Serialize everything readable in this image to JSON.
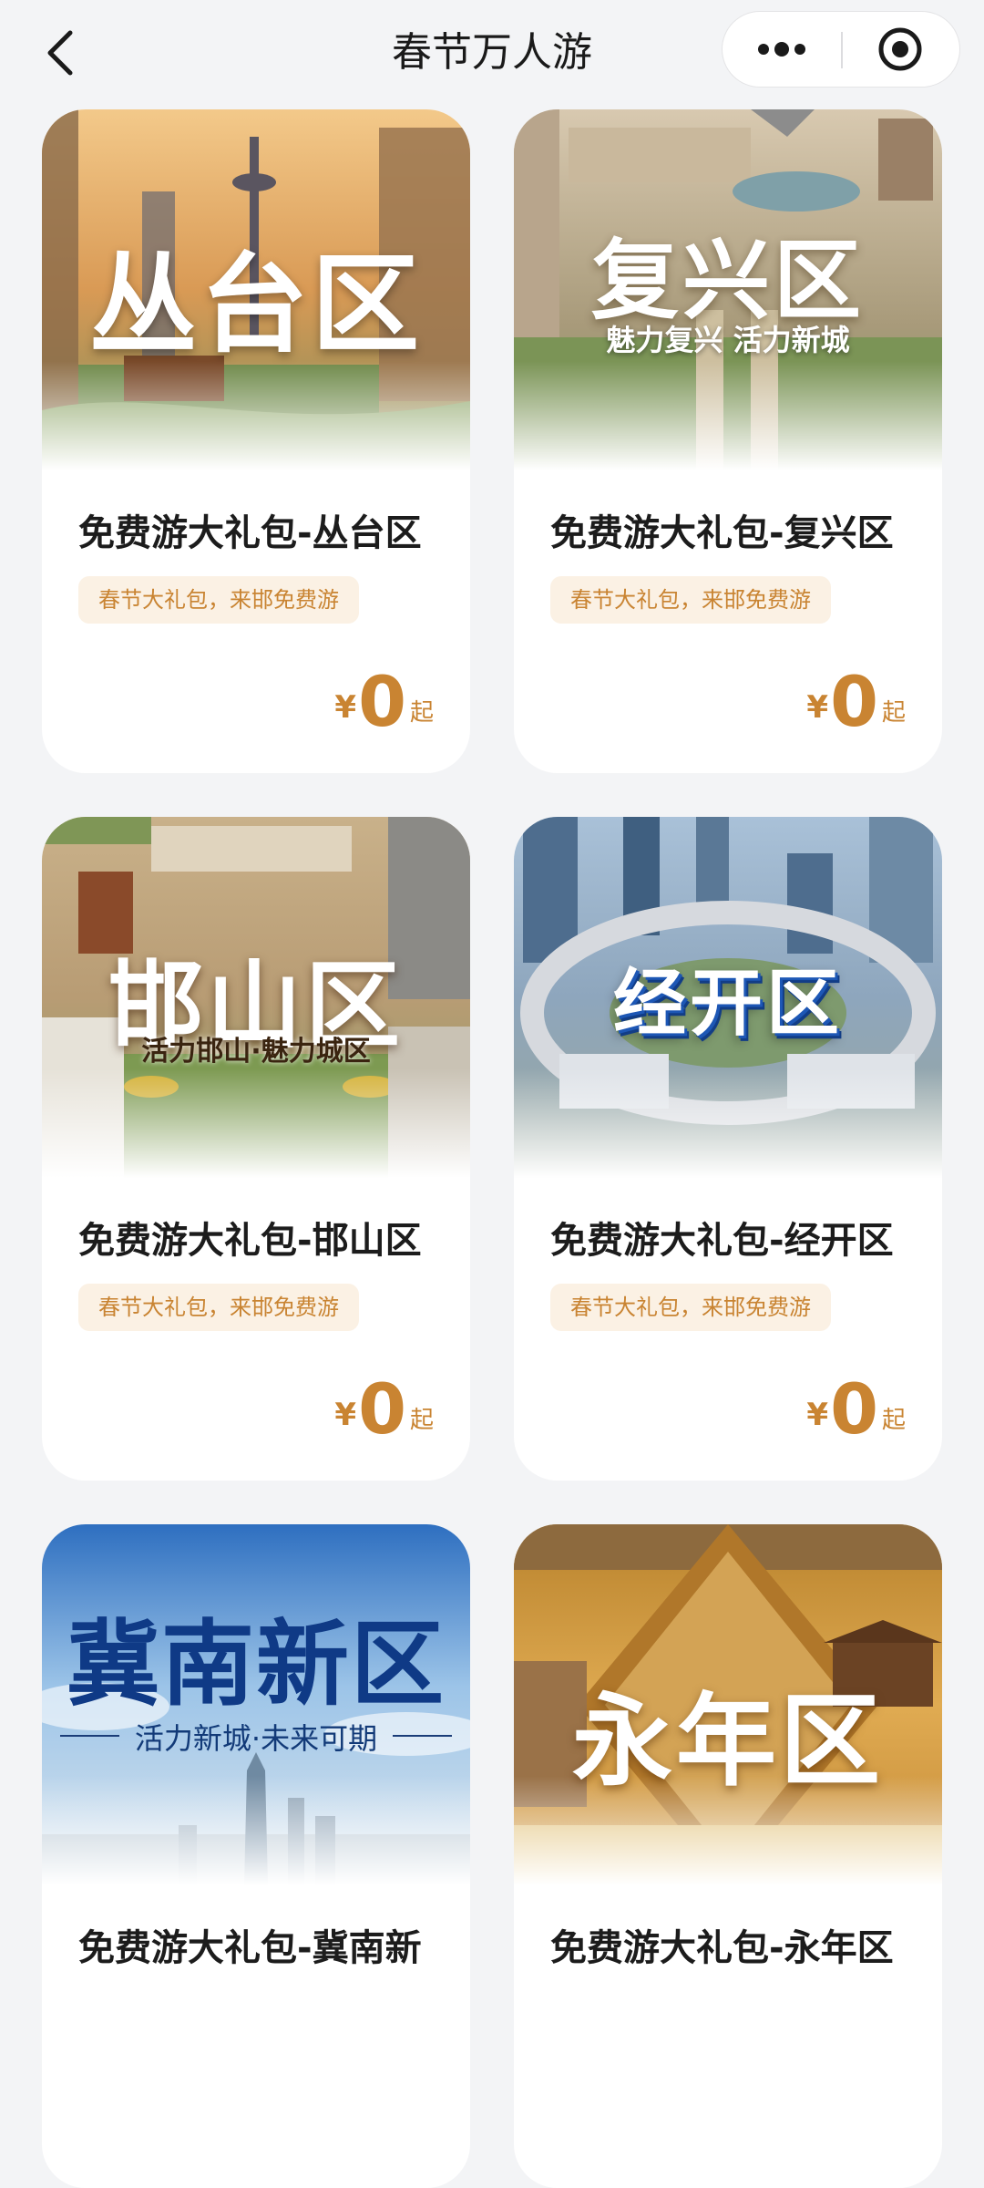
{
  "nav": {
    "title": "春节万人游",
    "icons": {
      "back": "chevron-left-icon",
      "more": "more-dots-icon",
      "close": "target-circle-icon"
    }
  },
  "cards": [
    {
      "banner_title": "丛台区",
      "banner_subtitle": "",
      "title": "免费游大礼包-丛台区",
      "tag": "春节大礼包，来邯免费游",
      "currency": "¥",
      "price": "0",
      "price_suffix": "起"
    },
    {
      "banner_title": "复兴区",
      "banner_subtitle": "魅力复兴 活力新城",
      "title": "免费游大礼包-复兴区",
      "tag": "春节大礼包，来邯免费游",
      "currency": "¥",
      "price": "0",
      "price_suffix": "起"
    },
    {
      "banner_title": "邯山区",
      "banner_subtitle": "活力邯山·魅力城区",
      "title": "免费游大礼包-邯山区",
      "tag": "春节大礼包，来邯免费游",
      "currency": "¥",
      "price": "0",
      "price_suffix": "起"
    },
    {
      "banner_title": "经开区",
      "banner_subtitle": "",
      "title": "免费游大礼包-经开区",
      "tag": "春节大礼包，来邯免费游",
      "currency": "¥",
      "price": "0",
      "price_suffix": "起"
    },
    {
      "banner_title": "冀南新区",
      "banner_subtitle": "活力新城·未来可期",
      "title": "免费游大礼包-冀南新",
      "tag": "",
      "currency": "",
      "price": "",
      "price_suffix": ""
    },
    {
      "banner_title": "永年区",
      "banner_subtitle": "",
      "title": "免费游大礼包-永年区",
      "tag": "",
      "currency": "",
      "price": "",
      "price_suffix": ""
    }
  ],
  "colors": {
    "background": "#f3f4f6",
    "accent": "#c98432",
    "tag_bg": "#fbf1e4",
    "title_text": "#1c1c1c"
  }
}
